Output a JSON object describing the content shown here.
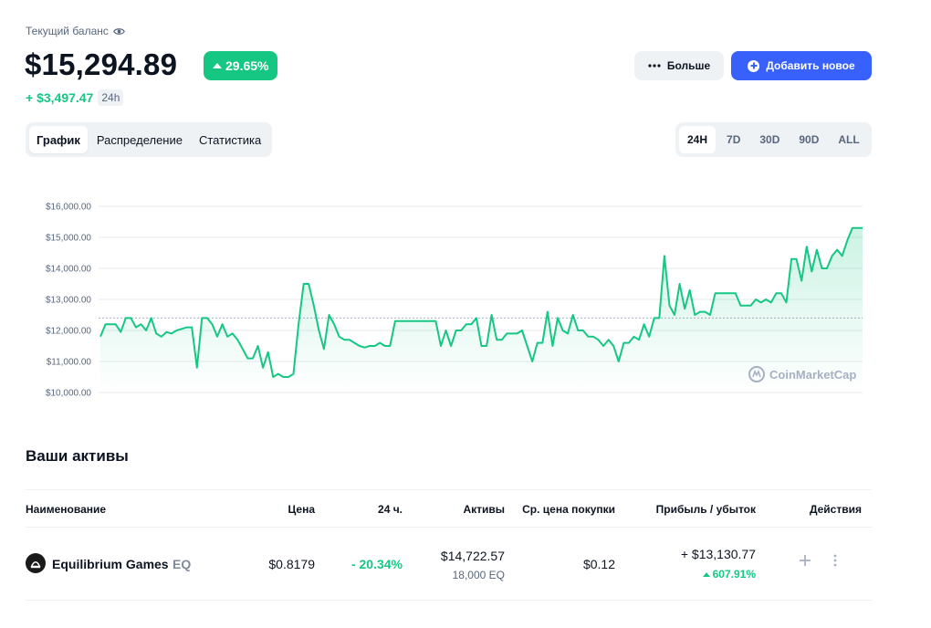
{
  "header": {
    "balance_label": "Текущий баланс",
    "balance": "$15,294.89",
    "change_pct": "29.65%",
    "pnl": "+ $3,497.47",
    "pnl_period": "24h"
  },
  "buttons": {
    "more": "Больше",
    "add": "Добавить новое"
  },
  "view_tabs": [
    "График",
    "Распределение",
    "Статистика"
  ],
  "active_view_tab": "График",
  "range_tabs": [
    "24H",
    "7D",
    "30D",
    "90D",
    "ALL"
  ],
  "active_range": "24H",
  "colors": {
    "accent": "#3861fb",
    "positive": "#16c784",
    "muted": "#58667e"
  },
  "chart_data": {
    "type": "area",
    "ylim": [
      10000,
      16000
    ],
    "y_ticks": [
      "$16,000.00",
      "$15,000.00",
      "$14,000.00",
      "$13,000.00",
      "$12,000.00",
      "$11,000.00",
      "$10,000.00"
    ],
    "reference_line": 12400,
    "watermark": "CoinMarketCap",
    "values": [
      11800,
      12200,
      12200,
      12200,
      11950,
      12400,
      12400,
      12100,
      12200,
      12000,
      12400,
      11900,
      11800,
      11950,
      11900,
      12000,
      12050,
      12100,
      12100,
      10800,
      12400,
      12400,
      12200,
      11800,
      12200,
      11800,
      11900,
      11700,
      11400,
      11100,
      11100,
      11500,
      10800,
      11300,
      10500,
      10600,
      10500,
      10500,
      10600,
      12200,
      13500,
      13500,
      12800,
      12000,
      11400,
      12500,
      12200,
      11800,
      11700,
      11700,
      11600,
      11500,
      11450,
      11500,
      11500,
      11600,
      11500,
      11500,
      12300,
      12300,
      12300,
      12300,
      12300,
      12300,
      12300,
      12300,
      12300,
      11500,
      12000,
      11500,
      12000,
      12000,
      12200,
      12200,
      12400,
      11500,
      11500,
      12500,
      11700,
      11700,
      11900,
      11900,
      11900,
      12000,
      11500,
      11000,
      11600,
      11600,
      12600,
      11500,
      12400,
      12000,
      11900,
      12500,
      12000,
      12000,
      11800,
      11800,
      11700,
      11500,
      11700,
      11500,
      11000,
      11600,
      11600,
      11800,
      11700,
      12200,
      11800,
      12400,
      12400,
      14400,
      12800,
      12500,
      13500,
      12700,
      13300,
      12500,
      12600,
      12600,
      12500,
      13200,
      13200,
      13200,
      13200,
      13200,
      12800,
      12800,
      12800,
      13000,
      12900,
      13000,
      12900,
      13200,
      13200,
      12900,
      14300,
      14300,
      13600,
      14700,
      13900,
      14600,
      14000,
      14000,
      14400,
      14600,
      14400,
      14900,
      15300,
      15300,
      15300
    ]
  },
  "assets": {
    "title": "Ваши активы",
    "columns": {
      "name": "Наименование",
      "price": "Цена",
      "change_24h": "24 ч.",
      "holdings": "Активы",
      "avg_price": "Ср. цена покупки",
      "pnl": "Прибыль / убыток",
      "actions": "Действия"
    },
    "rows": [
      {
        "name": "Equilibrium Games",
        "symbol": "EQ",
        "price": "$0.8179",
        "change_24h": "- 20.34%",
        "holdings_value": "$14,722.57",
        "holdings_qty": "18,000 EQ",
        "avg_price": "$0.12",
        "pnl": "+ $13,130.77",
        "pnl_pct": "607.91%"
      }
    ]
  }
}
